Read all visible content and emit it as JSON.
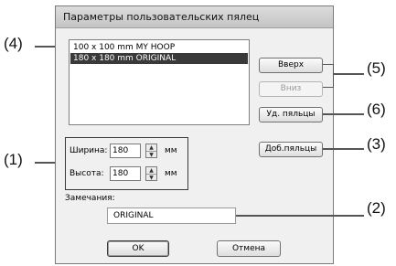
{
  "window": {
    "title": "Параметры пользовательских пялец"
  },
  "hoop_list": {
    "items": [
      {
        "label": "100 x 100 mm MY HOOP",
        "selected": false
      },
      {
        "label": "180 x 180 mm ORIGINAL",
        "selected": true
      }
    ]
  },
  "buttons": {
    "up": "Вверх",
    "down": "Вниз",
    "delete_hoop": "Уд. пяльцы",
    "add_hoop": "Доб.пяльцы",
    "ok": "OK",
    "cancel": "Отмена"
  },
  "size": {
    "width_label": "Ширина:",
    "width_value": "180",
    "width_unit": "мм",
    "height_label": "Высота:",
    "height_value": "180",
    "height_unit": "мм"
  },
  "notes": {
    "label": "Замечания:",
    "value": "ORIGINAL"
  },
  "callouts": {
    "c1": "(1)",
    "c2": "(2)",
    "c3": "(3)",
    "c4": "(4)",
    "c5": "(5)",
    "c6": "(6)"
  },
  "colors": {
    "dialog_bg": "#f0f0f0",
    "selection": "#3a3a3a",
    "callout_line": "#555555"
  }
}
